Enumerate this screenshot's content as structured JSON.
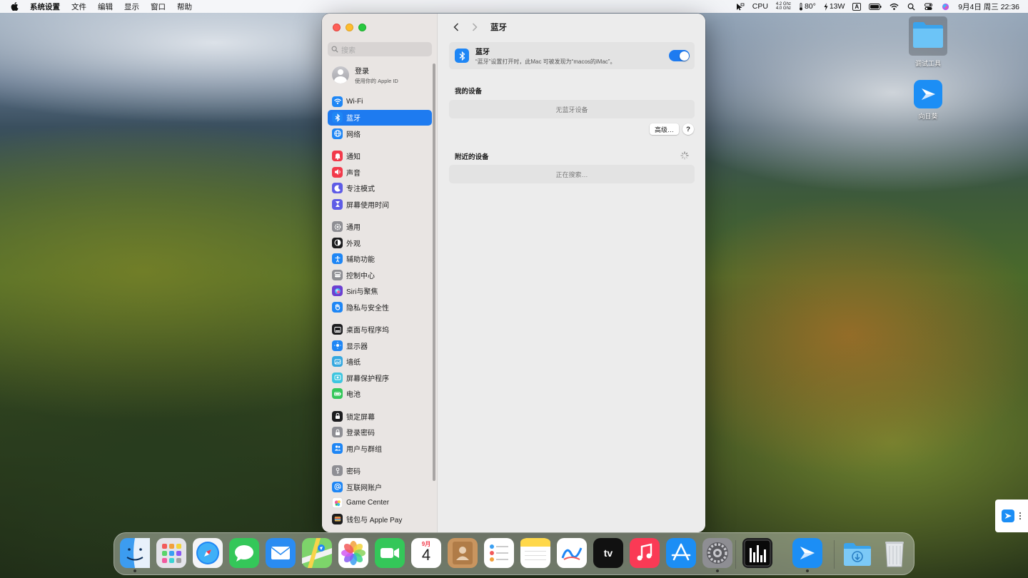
{
  "menubar": {
    "app_name": "系统设置",
    "menus": [
      "文件",
      "编辑",
      "显示",
      "窗口",
      "帮助"
    ],
    "cpu_label": "CPU",
    "cpu_freq_top": "4.2 Ghz",
    "cpu_freq_bottom": "4.0 Ghz",
    "temperature": "80°",
    "power": "13W",
    "input_source": "A",
    "datetime": "9月4日 周三 22:36"
  },
  "window": {
    "search_placeholder": "搜索",
    "account": {
      "title": "登录",
      "subtitle": "使用你的 Apple ID"
    },
    "sidebar_groups": [
      [
        {
          "label": "Wi-Fi",
          "icon": "wifi-icon",
          "color": "#1e86f5"
        },
        {
          "label": "蓝牙",
          "icon": "bluetooth-icon",
          "color": "#1e86f5",
          "active": true
        },
        {
          "label": "网络",
          "icon": "globe-icon",
          "color": "#1e86f5"
        }
      ],
      [
        {
          "label": "通知",
          "icon": "bell-icon",
          "color": "#f2394a"
        },
        {
          "label": "声音",
          "icon": "speaker-icon",
          "color": "#f2394a"
        },
        {
          "label": "专注模式",
          "icon": "moon-icon",
          "color": "#5e5ce6"
        },
        {
          "label": "屏幕使用时间",
          "icon": "hourglass-icon",
          "color": "#5e5ce6"
        }
      ],
      [
        {
          "label": "通用",
          "icon": "gear-icon",
          "color": "#8e8e93"
        },
        {
          "label": "外观",
          "icon": "appearance-icon",
          "color": "#1c1c1e"
        },
        {
          "label": "辅助功能",
          "icon": "accessibility-icon",
          "color": "#1e86f5"
        },
        {
          "label": "控制中心",
          "icon": "control-center-icon",
          "color": "#8e8e93"
        },
        {
          "label": "Siri与聚焦",
          "icon": "siri-icon",
          "color": "#6c3fd1"
        },
        {
          "label": "隐私与安全性",
          "icon": "hand-icon",
          "color": "#1e86f5"
        }
      ],
      [
        {
          "label": "桌面与程序坞",
          "icon": "dock-icon",
          "color": "#1c1c1e"
        },
        {
          "label": "显示器",
          "icon": "sun-icon",
          "color": "#1e86f5"
        },
        {
          "label": "墙纸",
          "icon": "wallpaper-icon",
          "color": "#34a8e0"
        },
        {
          "label": "屏幕保护程序",
          "icon": "screensaver-icon",
          "color": "#3ec6e0"
        },
        {
          "label": "电池",
          "icon": "battery-icon",
          "color": "#34c759"
        }
      ],
      [
        {
          "label": "锁定屏幕",
          "icon": "lock-icon",
          "color": "#1c1c1e"
        },
        {
          "label": "登录密码",
          "icon": "lock-icon",
          "color": "#8e8e93"
        },
        {
          "label": "用户与群组",
          "icon": "users-icon",
          "color": "#1e86f5"
        }
      ],
      [
        {
          "label": "密码",
          "icon": "key-icon",
          "color": "#8e8e93"
        },
        {
          "label": "互联网账户",
          "icon": "at-icon",
          "color": "#1e86f5"
        },
        {
          "label": "Game Center",
          "icon": "game-center-icon",
          "color": "#ffffff"
        },
        {
          "label": "钱包与 Apple Pay",
          "icon": "wallet-icon",
          "color": "#1c1c1e"
        }
      ]
    ],
    "toolbar_title": "蓝牙",
    "bluetooth": {
      "title": "蓝牙",
      "description": "“蓝牙”设置打开时，此Mac 可被发现为“macos的iMac”。",
      "enabled": true
    },
    "my_devices": {
      "heading": "我的设备",
      "empty_text": "无蓝牙设备"
    },
    "advanced_button": "高级…",
    "help_button": "?",
    "nearby_devices": {
      "heading": "附近的设备",
      "status_text": "正在搜索…"
    }
  },
  "desktop": {
    "items": [
      {
        "label": "调试工具",
        "icon": "folder-icon"
      },
      {
        "label": "向日葵",
        "icon": "sunlogin-icon"
      }
    ]
  },
  "dock": {
    "apps": [
      {
        "name": "finder-icon",
        "color": "#3c9cf0",
        "running": true
      },
      {
        "name": "launchpad-icon",
        "color": "#d9d9de"
      },
      {
        "name": "safari-icon",
        "color": "#ffffff"
      },
      {
        "name": "messages-icon",
        "color": "#34c759"
      },
      {
        "name": "mail-icon",
        "color": "#2a8cf2"
      },
      {
        "name": "maps-icon",
        "color": "#6ccf5a"
      },
      {
        "name": "photos-icon",
        "color": "#ffffff"
      },
      {
        "name": "facetime-icon",
        "color": "#34c759"
      },
      {
        "name": "calendar-icon",
        "color": "#ffffff"
      },
      {
        "name": "contacts-icon",
        "color": "#c9955f"
      },
      {
        "name": "reminders-icon",
        "color": "#ffffff"
      },
      {
        "name": "notes-icon",
        "color": "#ffe066"
      },
      {
        "name": "freeform-icon",
        "color": "#ffffff"
      },
      {
        "name": "apple-tv-icon",
        "color": "#111111"
      },
      {
        "name": "music-icon",
        "color": "#fa3a55"
      },
      {
        "name": "app-store-icon",
        "color": "#1c8ef5"
      },
      {
        "name": "system-settings-icon",
        "color": "#8e8e93",
        "running": true
      },
      {
        "name": "activity-monitor-icon",
        "color": "#1c1c1e"
      },
      {
        "name": "sunlogin-icon",
        "color": "#1c8ef5",
        "running": true
      },
      {
        "name": "downloads-folder-icon",
        "color": "#5cb4f2"
      },
      {
        "name": "trash-icon",
        "color": "#d9dde2"
      }
    ],
    "calendar_month": "9月",
    "calendar_day": "4",
    "tv_label": "tv"
  }
}
